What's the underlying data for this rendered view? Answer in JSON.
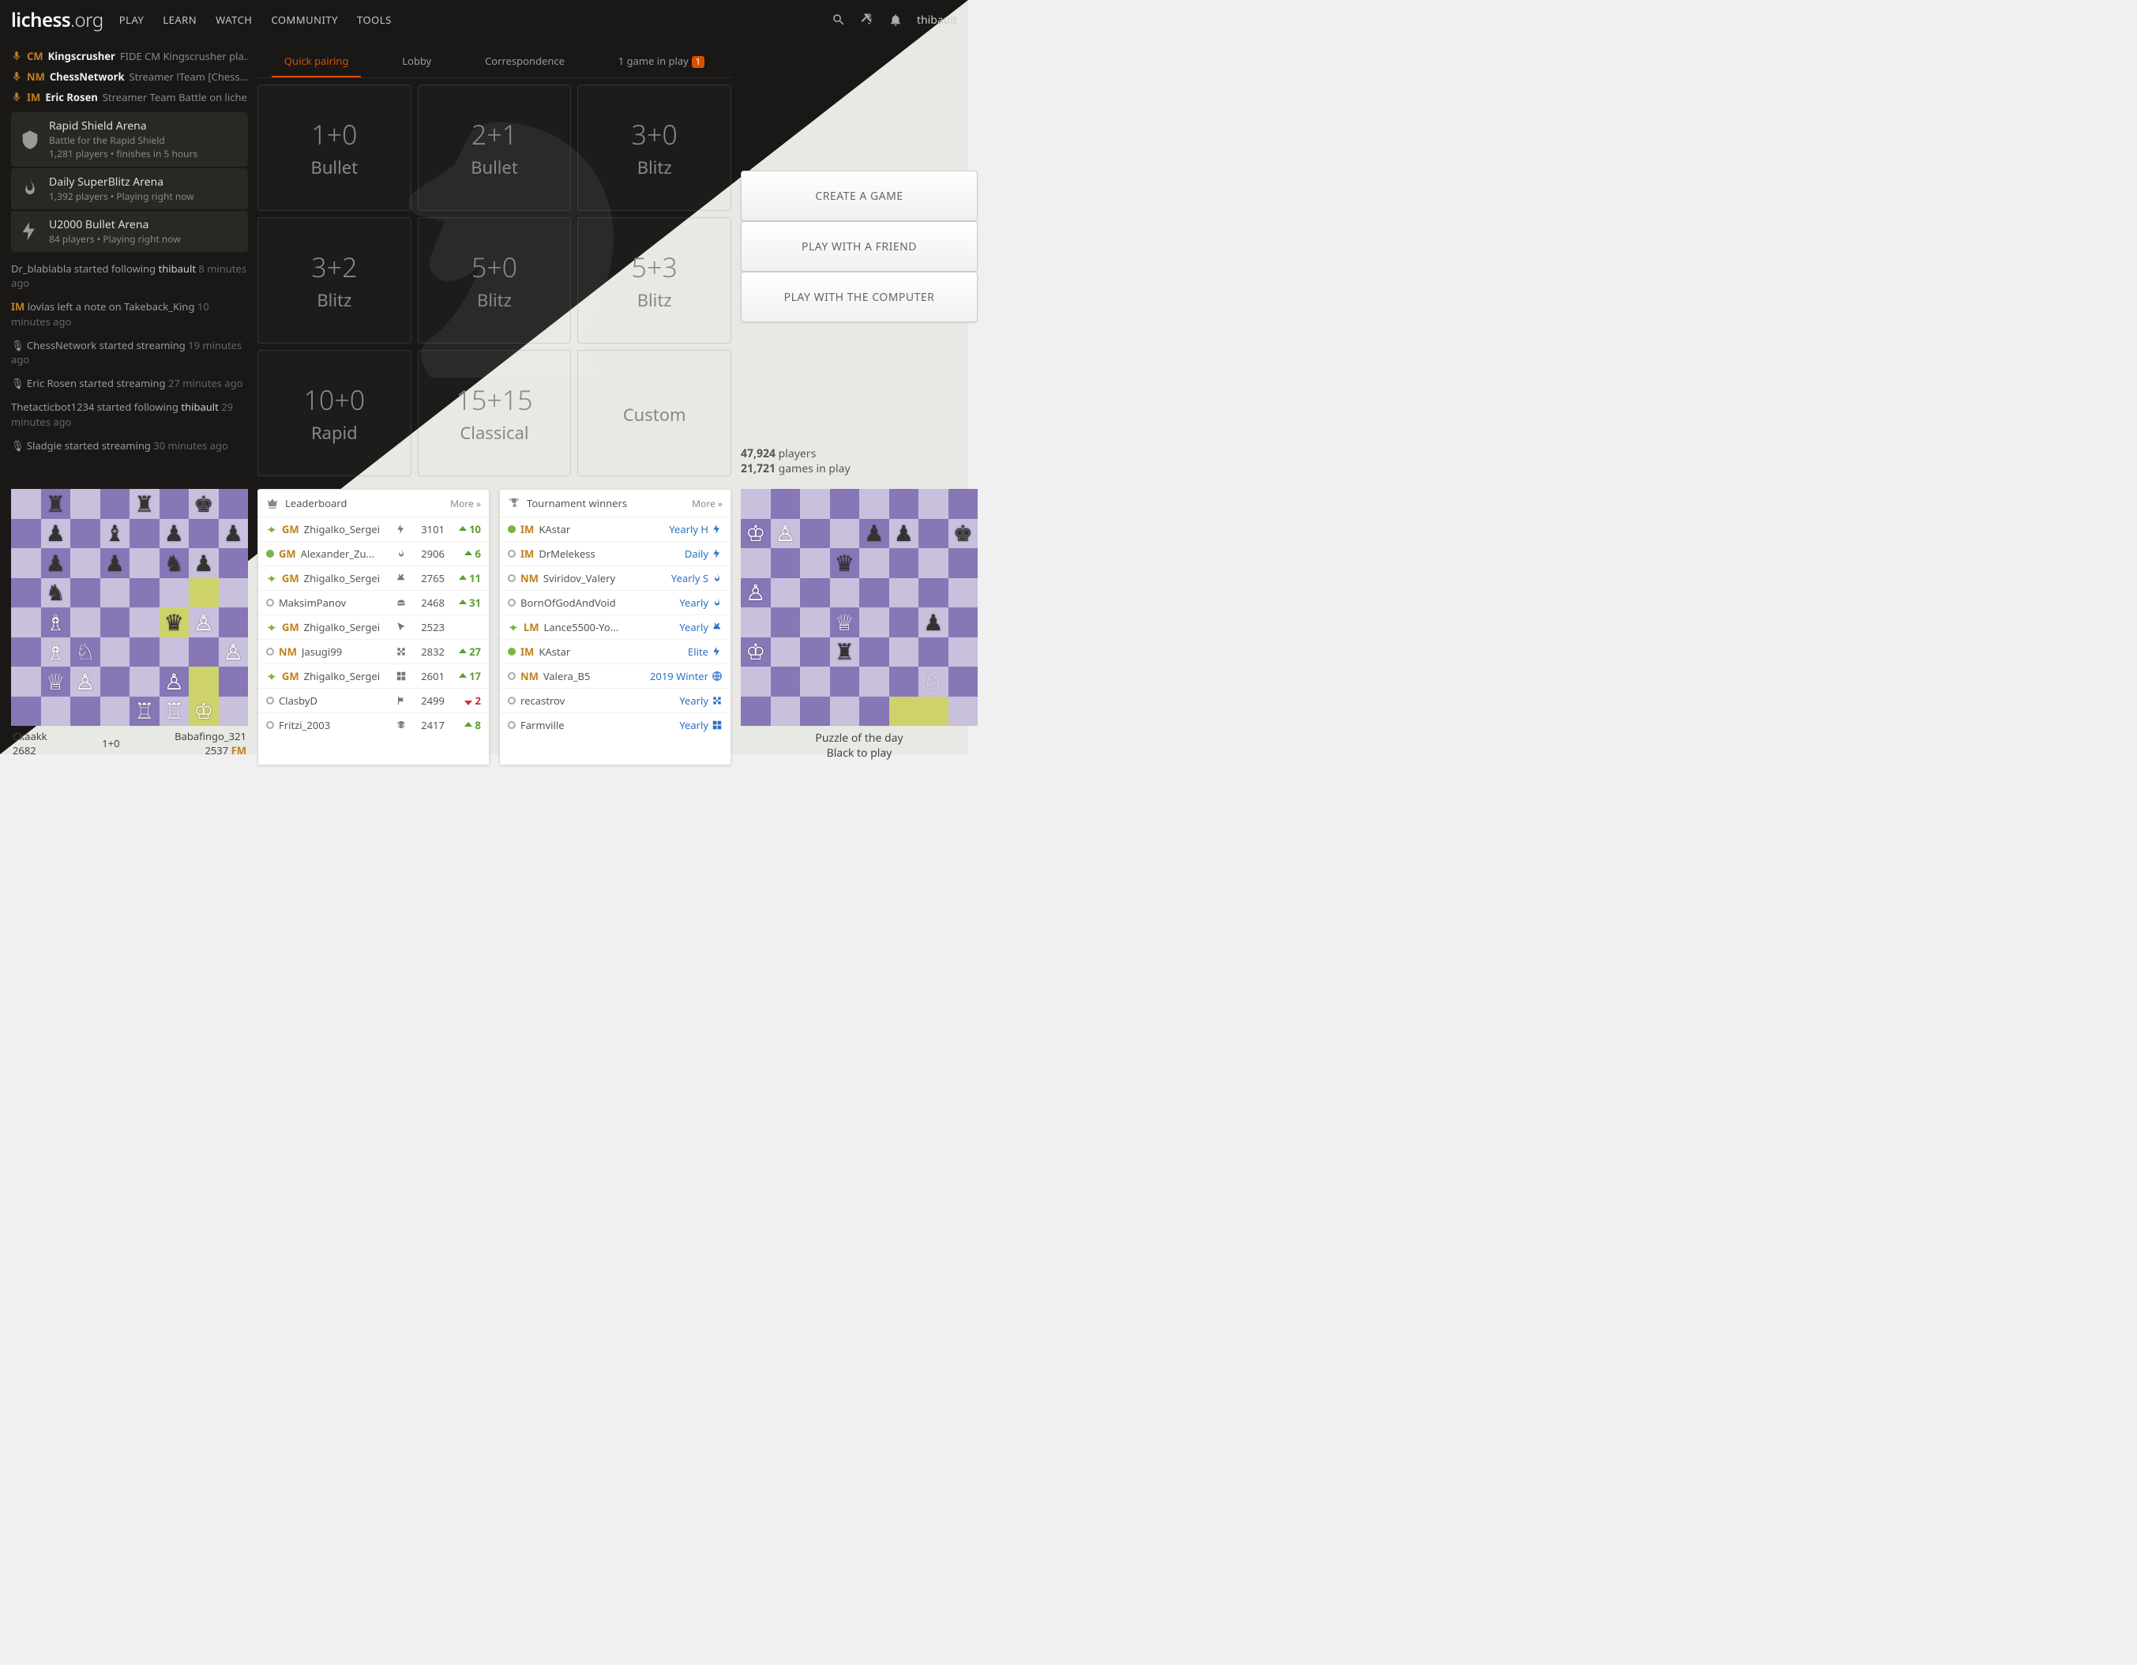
{
  "header": {
    "logo_main": "lichess",
    "logo_suffix": ".org",
    "nav": [
      "PLAY",
      "LEARN",
      "WATCH",
      "COMMUNITY",
      "TOOLS"
    ],
    "user": "thibault"
  },
  "streams": [
    {
      "title": "CM",
      "name": "Kingscrusher",
      "desc": "FIDE CM Kingscrusher pla..."
    },
    {
      "title": "NM",
      "name": "ChessNetwork",
      "desc": "Streamer !Team [Chess..."
    },
    {
      "title": "IM",
      "name": "Eric Rosen",
      "desc": "Streamer Team Battle on liche..."
    }
  ],
  "arenas": [
    {
      "name": "Rapid Shield Arena",
      "sub": "Battle for the Rapid Shield",
      "meta": "1,281 players • finishes  in 5 hours"
    },
    {
      "name": "Daily SuperBlitz Arena",
      "sub": "",
      "meta": "1,392 players • Playing right now"
    },
    {
      "name": "U2000 Bullet Arena",
      "sub": "",
      "meta": "84 players • Playing right now"
    }
  ],
  "feed": [
    {
      "html": "Dr_blablabla started following <b>thibault</b>",
      "ago": "8 minutes ago"
    },
    {
      "html": "<span class='im'>IM</span> lovlas left a note on Takeback_King",
      "ago": "10 minutes ago"
    },
    {
      "html": "🎙 ChessNetwork started streaming",
      "ago": "19 minutes ago"
    },
    {
      "html": "🎙 Eric Rosen started streaming",
      "ago": "27 minutes ago"
    },
    {
      "html": "Thetacticbot1234 started following <b>thibault</b>",
      "ago": "29 minutes ago"
    },
    {
      "html": "🎙 Sladgie started streaming",
      "ago": "30 minutes ago"
    }
  ],
  "tabs": {
    "items": [
      "Quick pairing",
      "Lobby",
      "Correspondence"
    ],
    "inplay_label": "1 game in play",
    "inplay_badge": "1",
    "active": 0
  },
  "cells": [
    {
      "tc": "1+0",
      "tp": "Bullet"
    },
    {
      "tc": "2+1",
      "tp": "Bullet"
    },
    {
      "tc": "3+0",
      "tp": "Blitz"
    },
    {
      "tc": "3+2",
      "tp": "Blitz"
    },
    {
      "tc": "5+0",
      "tp": "Blitz"
    },
    {
      "tc": "5+3",
      "tp": "Blitz"
    },
    {
      "tc": "10+0",
      "tp": "Rapid"
    },
    {
      "tc": "15+15",
      "tp": "Classical"
    },
    {
      "tc": "",
      "tp": "Custom"
    }
  ],
  "buttons": [
    "CREATE A GAME",
    "PLAY WITH A FRIEND",
    "PLAY WITH THE COMPUTER"
  ],
  "stats": {
    "players": "47,924",
    "players_l": " players",
    "games": "21,721",
    "games_l": " games in play"
  },
  "leaderboard": {
    "title": "Leaderboard",
    "more": "More »",
    "rows": [
      {
        "s": "wing",
        "t": "GM",
        "n": "Zhigalko_Sergei",
        "i": "bolt",
        "r": "3101",
        "d": "10",
        "dir": "up"
      },
      {
        "s": "on",
        "t": "GM",
        "n": "Alexander_Zu...",
        "i": "flame",
        "r": "2906",
        "d": "6",
        "dir": "up"
      },
      {
        "s": "wing",
        "t": "GM",
        "n": "Zhigalko_Sergei",
        "i": "rabbit",
        "r": "2765",
        "d": "11",
        "dir": "up"
      },
      {
        "s": "off",
        "t": "",
        "n": "MaksimPanov",
        "i": "turtle",
        "r": "2468",
        "d": "31",
        "dir": "up"
      },
      {
        "s": "wing",
        "t": "GM",
        "n": "Zhigalko_Sergei",
        "i": "cursor",
        "r": "2523",
        "d": "",
        "dir": ""
      },
      {
        "s": "off",
        "t": "NM",
        "n": "Jasugi99",
        "i": "cross",
        "r": "2832",
        "d": "27",
        "dir": "up"
      },
      {
        "s": "wing",
        "t": "GM",
        "n": "Zhigalko_Sergei",
        "i": "grid",
        "r": "2601",
        "d": "17",
        "dir": "up"
      },
      {
        "s": "off",
        "t": "",
        "n": "ClasbyD",
        "i": "flag",
        "r": "2499",
        "d": "2",
        "dir": "dn"
      },
      {
        "s": "off",
        "t": "",
        "n": "Fritzi_2003",
        "i": "stack",
        "r": "2417",
        "d": "8",
        "dir": "up"
      }
    ]
  },
  "winners": {
    "title": "Tournament winners",
    "more": "More »",
    "rows": [
      {
        "s": "on",
        "t": "IM",
        "n": "KAstar",
        "l": "Yearly H",
        "i": "bolt"
      },
      {
        "s": "off",
        "t": "IM",
        "n": "DrMelekess",
        "l": "Daily",
        "i": "bolt"
      },
      {
        "s": "off",
        "t": "NM",
        "n": "Sviridov_Valery",
        "l": "Yearly S",
        "i": "flame"
      },
      {
        "s": "off",
        "t": "",
        "n": "BornOfGodAndVoid",
        "l": "Yearly",
        "i": "flame"
      },
      {
        "s": "wing",
        "t": "LM",
        "n": "Lance5500-Yo...",
        "l": "Yearly",
        "i": "rabbit"
      },
      {
        "s": "on",
        "t": "IM",
        "n": "KAstar",
        "l": "Elite",
        "i": "bolt"
      },
      {
        "s": "off",
        "t": "NM",
        "n": "Valera_B5",
        "l": "2019 Winter",
        "i": "globe"
      },
      {
        "s": "off",
        "t": "",
        "n": "recastrov",
        "l": "Yearly",
        "i": "cross"
      },
      {
        "s": "off",
        "t": "",
        "n": "Farmville",
        "l": "Yearly",
        "i": "grid"
      }
    ]
  },
  "game": {
    "white": "Ckaakk",
    "wr": "2682",
    "black": "Babafingo_321",
    "br": "2537",
    "bt": "FM",
    "tc": "1+0",
    "fen": "1r2r1k1/1p1b1p1p/1p1p1np1/1n6/1B3qP1/1BN4P/1QP2P2/4RRK1",
    "hl": [
      "f4",
      "g5",
      "g1",
      "g2"
    ]
  },
  "puzzle": {
    "title": "Puzzle of the day",
    "sub": "Black to play",
    "fen": "8/KP2pp1k/3q4/P7/3Q2p1/K2r4/6N1/8",
    "hl": [
      "g1",
      "f1"
    ]
  }
}
